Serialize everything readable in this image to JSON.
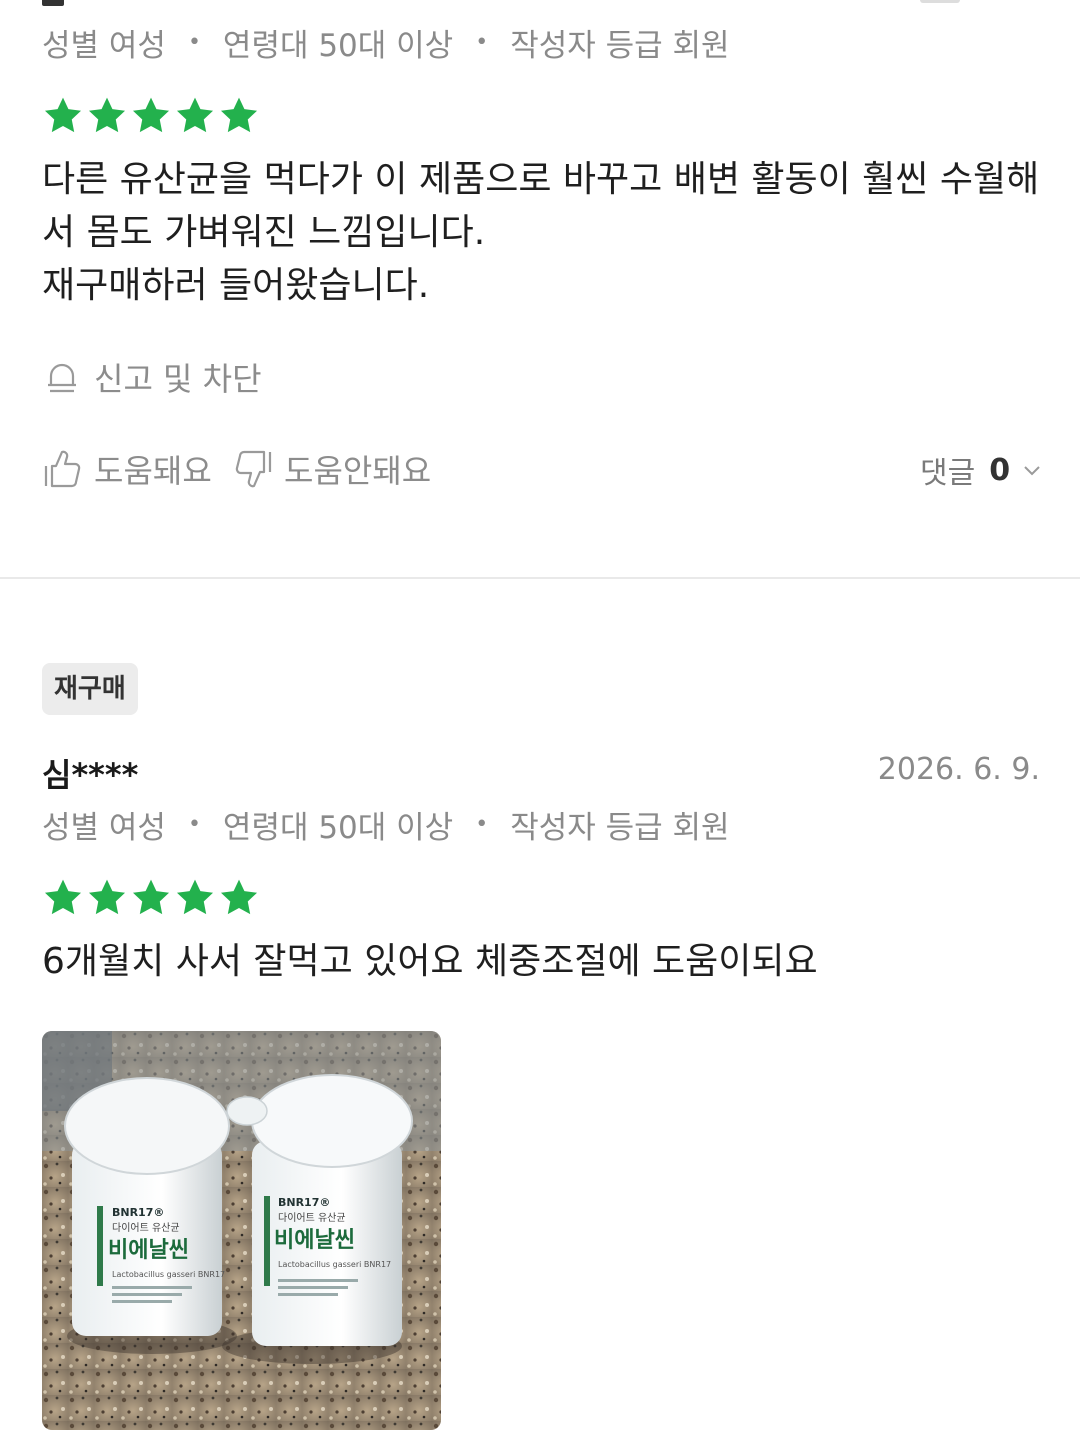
{
  "review1": {
    "meta": {
      "gender": "성별 여성",
      "age": "연령대 50대 이상",
      "grade": "작성자 등급 회원"
    },
    "rating": 5,
    "text_lines": [
      "다른 유산균을 먹다가 이 제품으로 바꾸고 배변 활동이 훨씬 수월해",
      "서 몸도 가벼워진 느낌입니다.",
      "재구매하러 들어왔습니다."
    ],
    "report_label": "신고 및 차단",
    "helpful_label": "도움돼요",
    "not_helpful_label": "도움안돼요",
    "comments_label": "댓글",
    "comments_count": "0"
  },
  "review2": {
    "badge": "재구매",
    "author": "심****",
    "date": "2026. 6. 9.",
    "meta": {
      "gender": "성별 여성",
      "age": "연령대 50대 이상",
      "grade": "작성자 등급 회원"
    },
    "rating": 5,
    "text": "6개월치 사서 잘먹고 있어요  체중조절에 도움이되요",
    "photo": {
      "left_bottle": {
        "brand": "BNR17®",
        "subtitle": "다이어트 유산균",
        "name": "비에날씬",
        "latin": "Lactobacillus gasseri BNR17"
      },
      "right_bottle": {
        "brand": "BNR17®",
        "subtitle": "다이어트 유산균",
        "name": "비에날씬",
        "latin": "Lactobacillus gasseri BNR17"
      }
    }
  },
  "colors": {
    "star": "#23b14d",
    "meta_text": "#8a8a8a",
    "divider": "#e9e9e9"
  },
  "icons": [
    "bell-icon",
    "thumbs-up-icon",
    "thumbs-down-icon",
    "chevron-down-icon",
    "star-icon"
  ]
}
